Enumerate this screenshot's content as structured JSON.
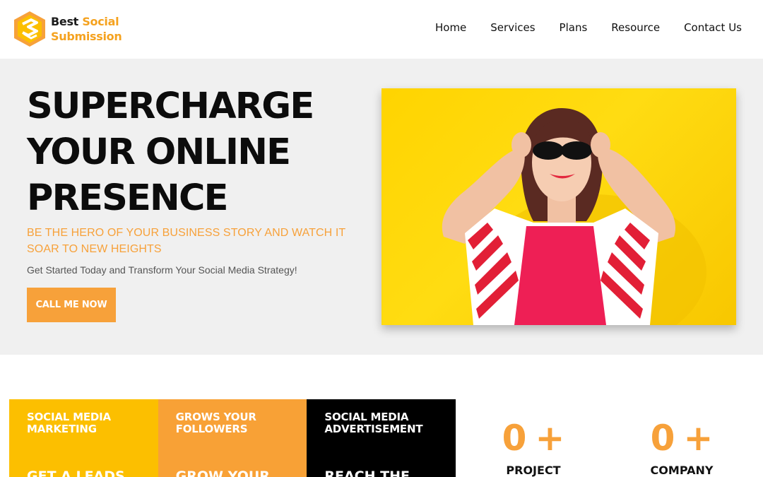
{
  "brand": {
    "line1_a": "Best",
    "line1_b": "Social",
    "line2": "Submission",
    "colors": {
      "accent": "#f7a13a",
      "yellow": "#fcbf00",
      "dark": "#000000"
    }
  },
  "nav": {
    "items": [
      "Home",
      "Services",
      "Plans",
      "Resource",
      "Contact Us"
    ]
  },
  "hero": {
    "title_lines": [
      "SUPERCHARGE",
      "YOUR ONLINE",
      "PRESENCE"
    ],
    "subtitle": "BE THE HERO OF YOUR BUSINESS STORY AND WATCH IT SOAR TO NEW HEIGHTS",
    "description": "Get Started Today and Transform Your Social Media Strategy!",
    "cta_label": "CALL ME NOW"
  },
  "services": [
    {
      "title": "SOCIAL MEDIA MARKETING",
      "body": "GET A LEADS"
    },
    {
      "title": "GROWS YOUR FOLLOWERS",
      "body": "GROW YOUR"
    },
    {
      "title": "SOCIAL MEDIA ADVERTISEMENT",
      "body": "REACH THE"
    }
  ],
  "counters": [
    {
      "value": "0",
      "suffix": "+",
      "label": "PROJECT"
    },
    {
      "value": "0",
      "suffix": "+",
      "label": "COMPANY"
    }
  ]
}
